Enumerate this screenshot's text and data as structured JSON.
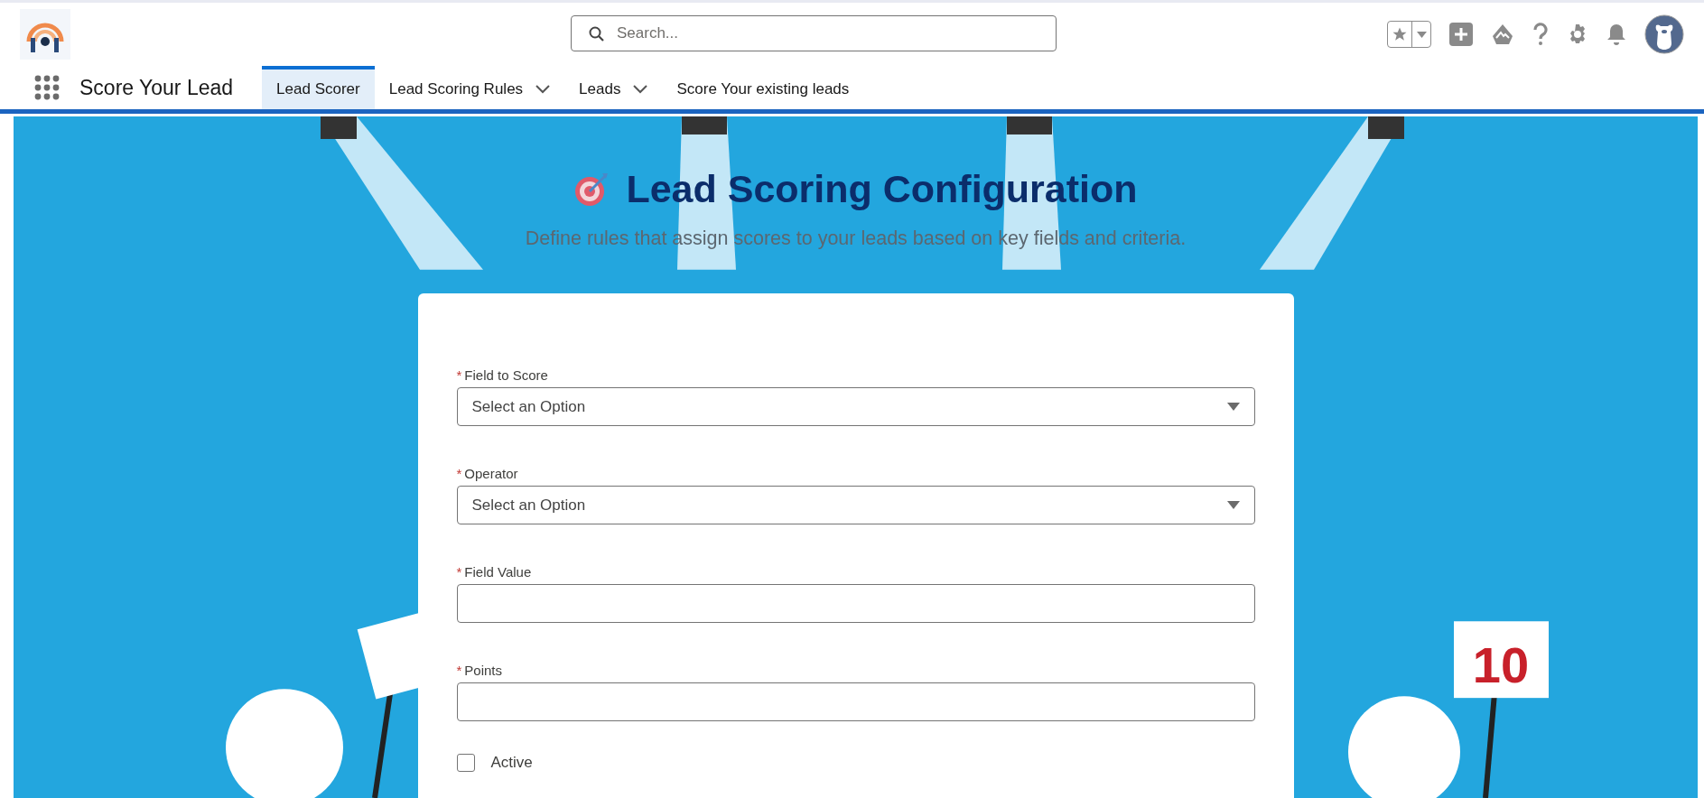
{
  "header": {
    "search": {
      "placeholder": "Search..."
    }
  },
  "nav": {
    "app_name": "Score Your Lead",
    "tabs": [
      {
        "label": "Lead Scorer",
        "selected": true,
        "has_menu": false
      },
      {
        "label": "Lead Scoring Rules",
        "selected": false,
        "has_menu": true
      },
      {
        "label": "Leads",
        "selected": false,
        "has_menu": true
      },
      {
        "label": "Score Your existing leads",
        "selected": false,
        "has_menu": false
      }
    ]
  },
  "backdrop": {
    "sign_text": "10"
  },
  "page": {
    "title": "Lead Scoring Configuration",
    "subtitle": "Define rules that assign scores to your leads based on key fields and criteria."
  },
  "form": {
    "fields": [
      {
        "kind": "select",
        "required_mark": "*",
        "label": "Field to Score",
        "placeholder": "Select an Option"
      },
      {
        "kind": "select",
        "required_mark": "*",
        "label": "Operator",
        "placeholder": "Select an Option"
      },
      {
        "kind": "text",
        "required_mark": "*",
        "label": "Field Value"
      },
      {
        "kind": "text",
        "required_mark": "*",
        "label": "Points"
      },
      {
        "kind": "checkbox",
        "label": "Active",
        "checked": false
      }
    ]
  }
}
